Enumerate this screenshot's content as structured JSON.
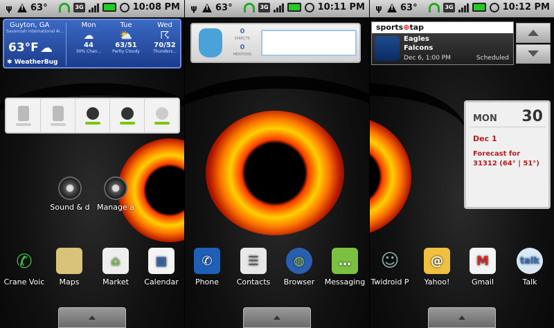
{
  "statusbar": {
    "battery_pct": "63°",
    "network": "3G",
    "times": [
      "10:08 PM",
      "10:11 PM",
      "10:12 PM"
    ]
  },
  "weather": {
    "city": "Guyton, GA",
    "station": "Savannah International Ai...",
    "current_temp": "63°F",
    "brand": "WeatherBug",
    "days": [
      {
        "name": "Mon",
        "temp": "44",
        "desc": "30% Chan..."
      },
      {
        "name": "Tue",
        "temp": "63/51",
        "desc": "Partly Cloudy"
      },
      {
        "name": "Wed",
        "temp": "70/52",
        "desc": "Thunders..."
      }
    ]
  },
  "shortcuts": [
    {
      "label": "Sound & d"
    },
    {
      "label": "Manage a"
    }
  ],
  "panel1_dock": [
    {
      "label": "Crane Voic",
      "icon": "phone-voice-icon",
      "color": "#2e7d32"
    },
    {
      "label": "Maps",
      "icon": "maps-icon",
      "color": "#d9c27a"
    },
    {
      "label": "Market",
      "icon": "market-bag-icon",
      "color": "#eeeeee"
    },
    {
      "label": "Calendar",
      "icon": "calendar-icon",
      "color": "#f4f4f4"
    }
  ],
  "twitter": {
    "directs_count": "0",
    "directs_label": "DIRECTS",
    "mentions_count": "0",
    "mentions_label": "MENTIONS"
  },
  "panel2_dock": [
    {
      "label": "Phone",
      "icon": "phone-icon",
      "color": "#1f5fb8"
    },
    {
      "label": "Contacts",
      "icon": "contacts-icon",
      "color": "#e8e8e8"
    },
    {
      "label": "Browser",
      "icon": "globe-icon",
      "color": "#2a5fb0"
    },
    {
      "label": "Messaging",
      "icon": "messaging-icon",
      "color": "#7ac142"
    }
  ],
  "sportstap": {
    "brand_a": "sports",
    "brand_b": "tap",
    "team1": "Eagles",
    "team2": "Falcons",
    "date": "Dec 6, 1:00 PM",
    "status": "Scheduled"
  },
  "calendar": {
    "dow": "MON",
    "day": "30",
    "event_date": "Dec 1",
    "forecast": "Forecast for 31312 (64° | 51°)"
  },
  "panel3_dock": [
    {
      "label": "Twidroid P",
      "icon": "twidroid-icon",
      "color": "#5a6a7a"
    },
    {
      "label": "Yahoo!",
      "icon": "yahoo-mail-icon",
      "color": "#f0c040"
    },
    {
      "label": "Gmail",
      "icon": "gmail-icon",
      "color": "#f4f4f4"
    },
    {
      "label": "Talk",
      "icon": "talk-icon",
      "color": "#d9e8f5"
    }
  ]
}
